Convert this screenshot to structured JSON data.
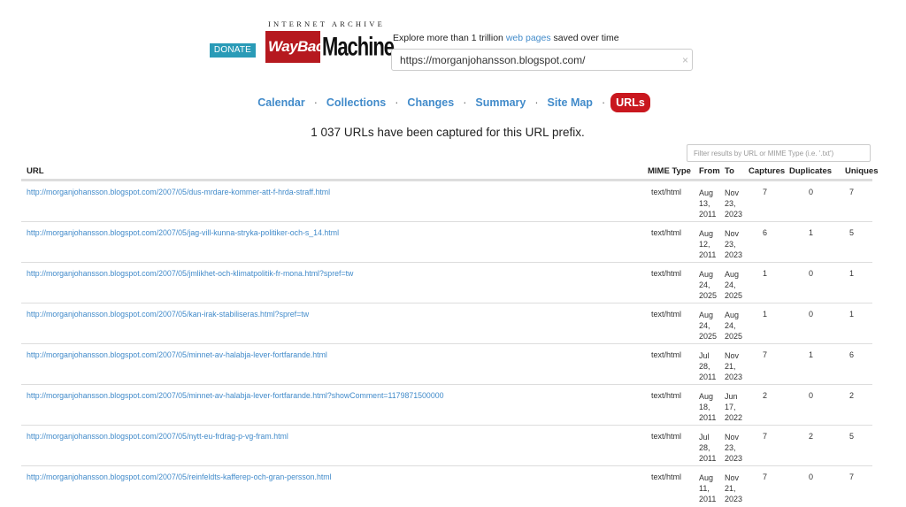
{
  "header": {
    "donate_label": "DONATE",
    "logo_top_text": "INTERNET ARCHIVE",
    "logo_way": "WayBack",
    "logo_machine": "Machine",
    "tagline_prefix": "Explore more than 1 trillion ",
    "tagline_link": "web pages",
    "tagline_suffix": " saved over time",
    "search_value": "https://morganjohansson.blogspot.com/",
    "clear_glyph": "×"
  },
  "nav": {
    "items": [
      {
        "label": "Calendar"
      },
      {
        "label": "Collections"
      },
      {
        "label": "Changes"
      },
      {
        "label": "Summary"
      },
      {
        "label": "Site Map"
      },
      {
        "label": "URLs",
        "active": true
      }
    ],
    "separator": "·"
  },
  "summary_text": "1 037 URLs have been captured for this URL prefix.",
  "filter_placeholder": "Filter results by URL or MIME Type (i.e. '.txt')",
  "table": {
    "columns": [
      "URL",
      "MIME Type",
      "From",
      "To",
      "Captures",
      "Duplicates",
      "Uniques"
    ],
    "rows": [
      {
        "url": "http://morganjohansson.blogspot.com/2007/05/dus-mrdare-kommer-att-f-hrda-straff.html",
        "mime": "text/html",
        "from": [
          "Aug",
          "13,",
          "2011"
        ],
        "to": [
          "Nov",
          "23,",
          "2023"
        ],
        "captures": "7",
        "duplicates": "0",
        "uniques": "7"
      },
      {
        "url": "http://morganjohansson.blogspot.com/2007/05/jag-vill-kunna-stryka-politiker-och-s_14.html",
        "mime": "text/html",
        "from": [
          "Aug",
          "12,",
          "2011"
        ],
        "to": [
          "Nov",
          "23,",
          "2023"
        ],
        "captures": "6",
        "duplicates": "1",
        "uniques": "5"
      },
      {
        "url": "http://morganjohansson.blogspot.com/2007/05/jmlikhet-och-klimatpolitik-fr-mona.html?spref=tw",
        "mime": "text/html",
        "from": [
          "Aug",
          "24,",
          "2025"
        ],
        "to": [
          "Aug",
          "24,",
          "2025"
        ],
        "captures": "1",
        "duplicates": "0",
        "uniques": "1"
      },
      {
        "url": "http://morganjohansson.blogspot.com/2007/05/kan-irak-stabiliseras.html?spref=tw",
        "mime": "text/html",
        "from": [
          "Aug",
          "24,",
          "2025"
        ],
        "to": [
          "Aug",
          "24,",
          "2025"
        ],
        "captures": "1",
        "duplicates": "0",
        "uniques": "1"
      },
      {
        "url": "http://morganjohansson.blogspot.com/2007/05/minnet-av-halabja-lever-fortfarande.html",
        "mime": "text/html",
        "from": [
          "Jul",
          "28,",
          "2011"
        ],
        "to": [
          "Nov",
          "21,",
          "2023"
        ],
        "captures": "7",
        "duplicates": "1",
        "uniques": "6"
      },
      {
        "url": "http://morganjohansson.blogspot.com/2007/05/minnet-av-halabja-lever-fortfarande.html?showComment=1179871500000",
        "mime": "text/html",
        "from": [
          "Aug",
          "18,",
          "2011"
        ],
        "to": [
          "Jun",
          "17,",
          "2022"
        ],
        "captures": "2",
        "duplicates": "0",
        "uniques": "2"
      },
      {
        "url": "http://morganjohansson.blogspot.com/2007/05/nytt-eu-frdrag-p-vg-fram.html",
        "mime": "text/html",
        "from": [
          "Jul",
          "28,",
          "2011"
        ],
        "to": [
          "Nov",
          "23,",
          "2023"
        ],
        "captures": "7",
        "duplicates": "2",
        "uniques": "5"
      },
      {
        "url": "http://morganjohansson.blogspot.com/2007/05/reinfeldts-kafferep-och-gran-persson.html",
        "mime": "text/html",
        "from": [
          "Aug",
          "11,",
          "2011"
        ],
        "to": [
          "Nov",
          "21,",
          "2023"
        ],
        "captures": "7",
        "duplicates": "0",
        "uniques": "7"
      }
    ]
  },
  "colors": {
    "brand_red": "#c9171e",
    "link_blue": "#428bca",
    "donate_teal": "#2a9bb7"
  }
}
